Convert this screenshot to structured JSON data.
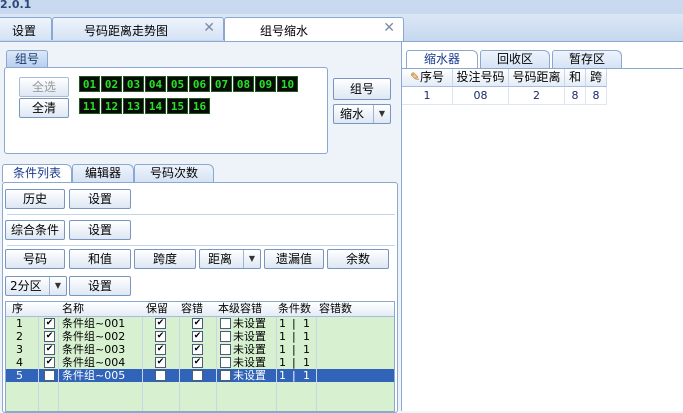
{
  "topbar": {
    "text": "2.0.1"
  },
  "tabs": {
    "tab0_label": "设置",
    "tab1_label": "号码距离走势图",
    "tab2_label": "组号缩水",
    "close_glyph": "✕"
  },
  "group_panel": {
    "title": "组号",
    "select_all": "全选",
    "clear_all": "全清",
    "numbers_row1": [
      "01",
      "02",
      "03",
      "04",
      "05",
      "06",
      "07",
      "08",
      "09",
      "10"
    ],
    "numbers_row2": [
      "11",
      "12",
      "13",
      "14",
      "15",
      "16"
    ],
    "group_button": "组号",
    "shrink_button": "缩水"
  },
  "condition_tabs": {
    "tab_list": "条件列表",
    "tab_editor": "编辑器",
    "tab_count": "号码次数"
  },
  "toolbar": {
    "history": "历史",
    "settings1": "设置",
    "combined": "综合条件",
    "settings2": "设置",
    "number": "号码",
    "sum": "和值",
    "span": "跨度",
    "distance": "距离",
    "missing": "遗漏值",
    "remainder": "余数",
    "zone": "2分区",
    "settings3": "设置"
  },
  "grid": {
    "headers": {
      "seq": "序",
      "name": "名称",
      "keep": "保留",
      "tolerance": "容错",
      "level_tol": "本级容错",
      "count": "条件数",
      "tol_count": "容错数"
    },
    "rows": [
      {
        "seq": "1",
        "checked": true,
        "name": "条件组~001",
        "keep": true,
        "tol": true,
        "level_tol": "未设置",
        "count": "1",
        "tol_count": "1"
      },
      {
        "seq": "2",
        "checked": true,
        "name": "条件组~002",
        "keep": true,
        "tol": true,
        "level_tol": "未设置",
        "count": "1",
        "tol_count": "1"
      },
      {
        "seq": "3",
        "checked": true,
        "name": "条件组~003",
        "keep": true,
        "tol": true,
        "level_tol": "未设置",
        "count": "1",
        "tol_count": "1"
      },
      {
        "seq": "4",
        "checked": true,
        "name": "条件组~004",
        "keep": true,
        "tol": true,
        "level_tol": "未设置",
        "count": "1",
        "tol_count": "1"
      },
      {
        "seq": "5",
        "checked": true,
        "name": "条件组~005",
        "keep": true,
        "tol": true,
        "level_tol": "未设置",
        "count": "1",
        "tol_count": "1"
      }
    ],
    "selected_row": 4,
    "row_color": "#d6f0d0",
    "selected_color": "#3163b8"
  },
  "right_panel": {
    "tab_shrinker": "缩水器",
    "tab_recycle": "回收区",
    "tab_temp": "暂存区",
    "headers": {
      "seq": "序号",
      "bet": "投注号码",
      "dist": "号码距离",
      "sum": "和",
      "span": "跨"
    },
    "rows": [
      {
        "seq": "1",
        "bet": "08",
        "dist": "2",
        "sum": "8",
        "span": "8"
      }
    ]
  },
  "colors": {
    "accent": "#8aa8d0",
    "led_green": "#27e027"
  }
}
